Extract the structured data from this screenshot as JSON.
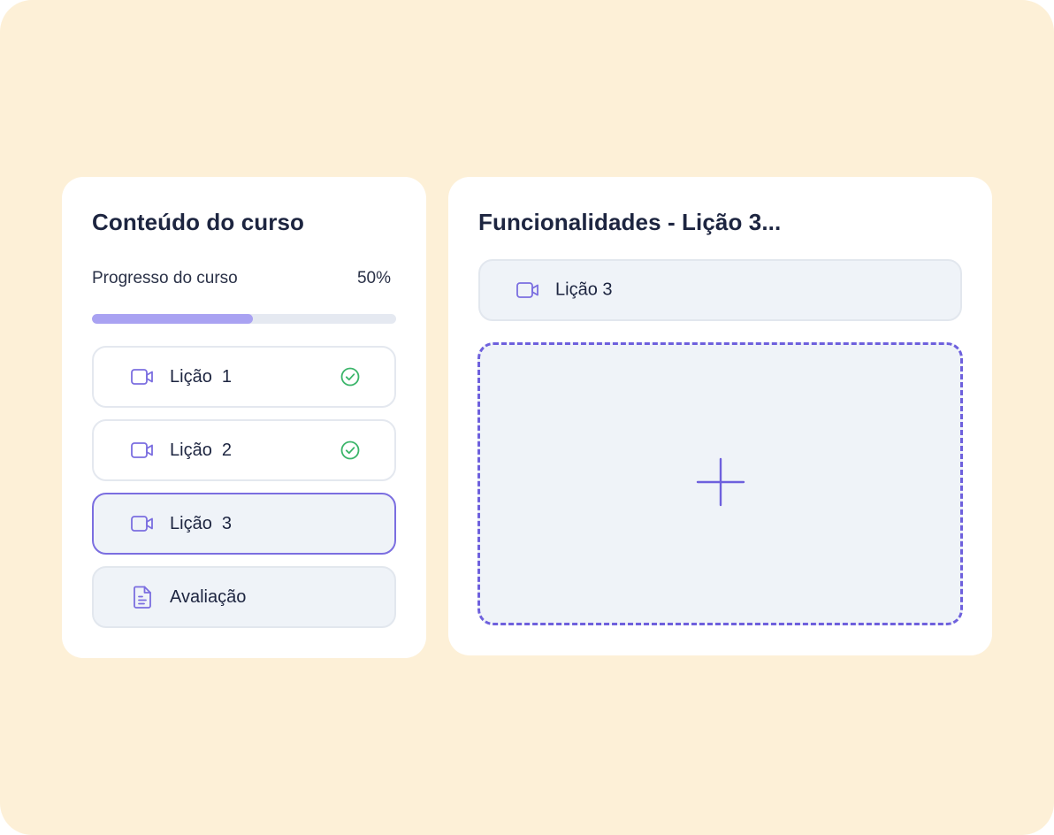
{
  "course_panel": {
    "title": "Conteúdo do curso",
    "progress_label": "Progresso do curso",
    "progress_value": "50%",
    "progress_fraction": 0.53,
    "lessons": [
      {
        "label": "Lição  1",
        "icon": "video-camera-icon",
        "status": "completed"
      },
      {
        "label": "Lição  2",
        "icon": "video-camera-icon",
        "status": "completed"
      },
      {
        "label": "Lição  3",
        "icon": "video-camera-icon",
        "status": "active"
      },
      {
        "label": "Avaliação",
        "icon": "document-icon",
        "status": "pending"
      }
    ]
  },
  "feature_panel": {
    "title": "Funcionalidades - Lição 3...",
    "item": {
      "label": "Lição 3",
      "icon": "video-camera-icon"
    },
    "dropzone_icon": "plus-icon"
  },
  "colors": {
    "background": "#fdf0d7",
    "accent": "#7b6ee0",
    "progress_fill": "#a9a2f2",
    "success": "#3bb56a",
    "text": "#1d2540"
  }
}
